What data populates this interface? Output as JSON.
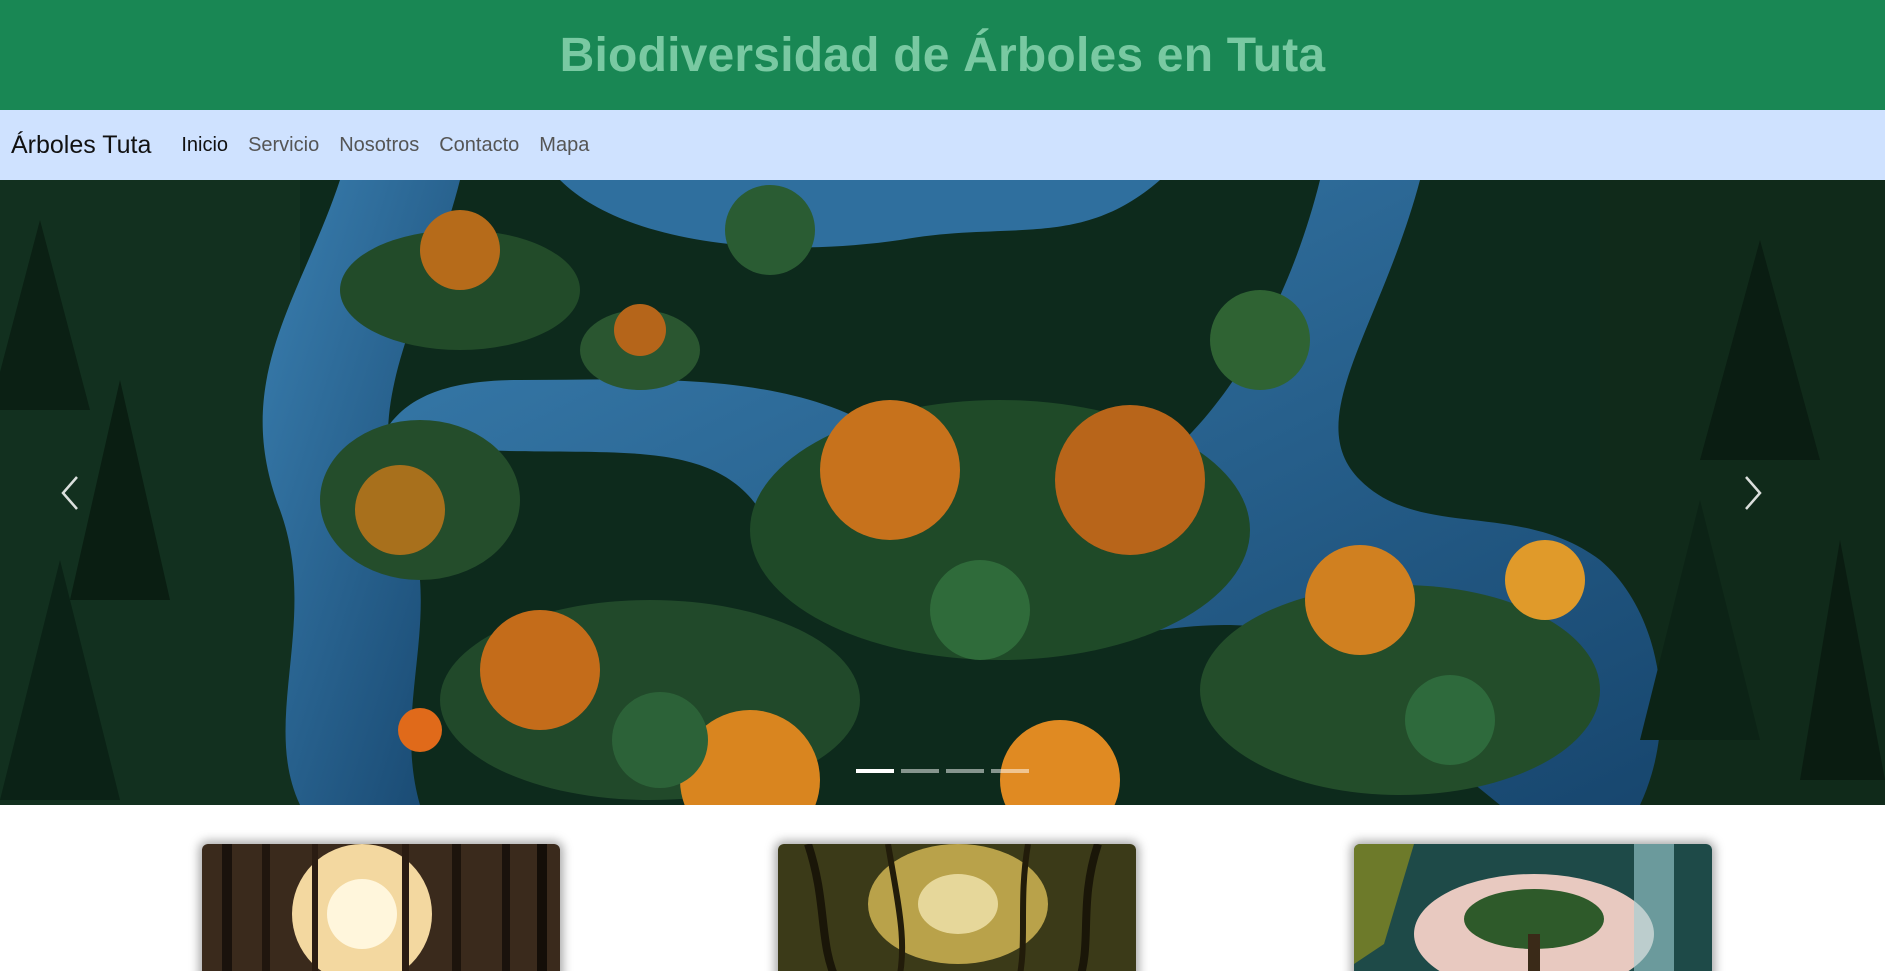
{
  "header": {
    "title": "Biodiversidad de Árboles en Tuta"
  },
  "navbar": {
    "brand": "Árboles Tuta",
    "items": [
      {
        "label": "Inicio",
        "active": true
      },
      {
        "label": "Servicio",
        "active": false
      },
      {
        "label": "Nosotros",
        "active": false
      },
      {
        "label": "Contacto",
        "active": false
      },
      {
        "label": "Mapa",
        "active": false
      }
    ]
  },
  "carousel": {
    "slide_count": 4,
    "active_slide": 1,
    "prev_icon": "chevron-left-icon",
    "next_icon": "chevron-right-icon"
  },
  "cards": [
    {
      "image": "sunlit-pine-forest"
    },
    {
      "image": "misty-golden-forest"
    },
    {
      "image": "mystical-tree-waterfall"
    }
  ],
  "colors": {
    "header_bg": "#198754",
    "header_text": "#79c9a2",
    "navbar_bg": "#cfe2ff"
  }
}
